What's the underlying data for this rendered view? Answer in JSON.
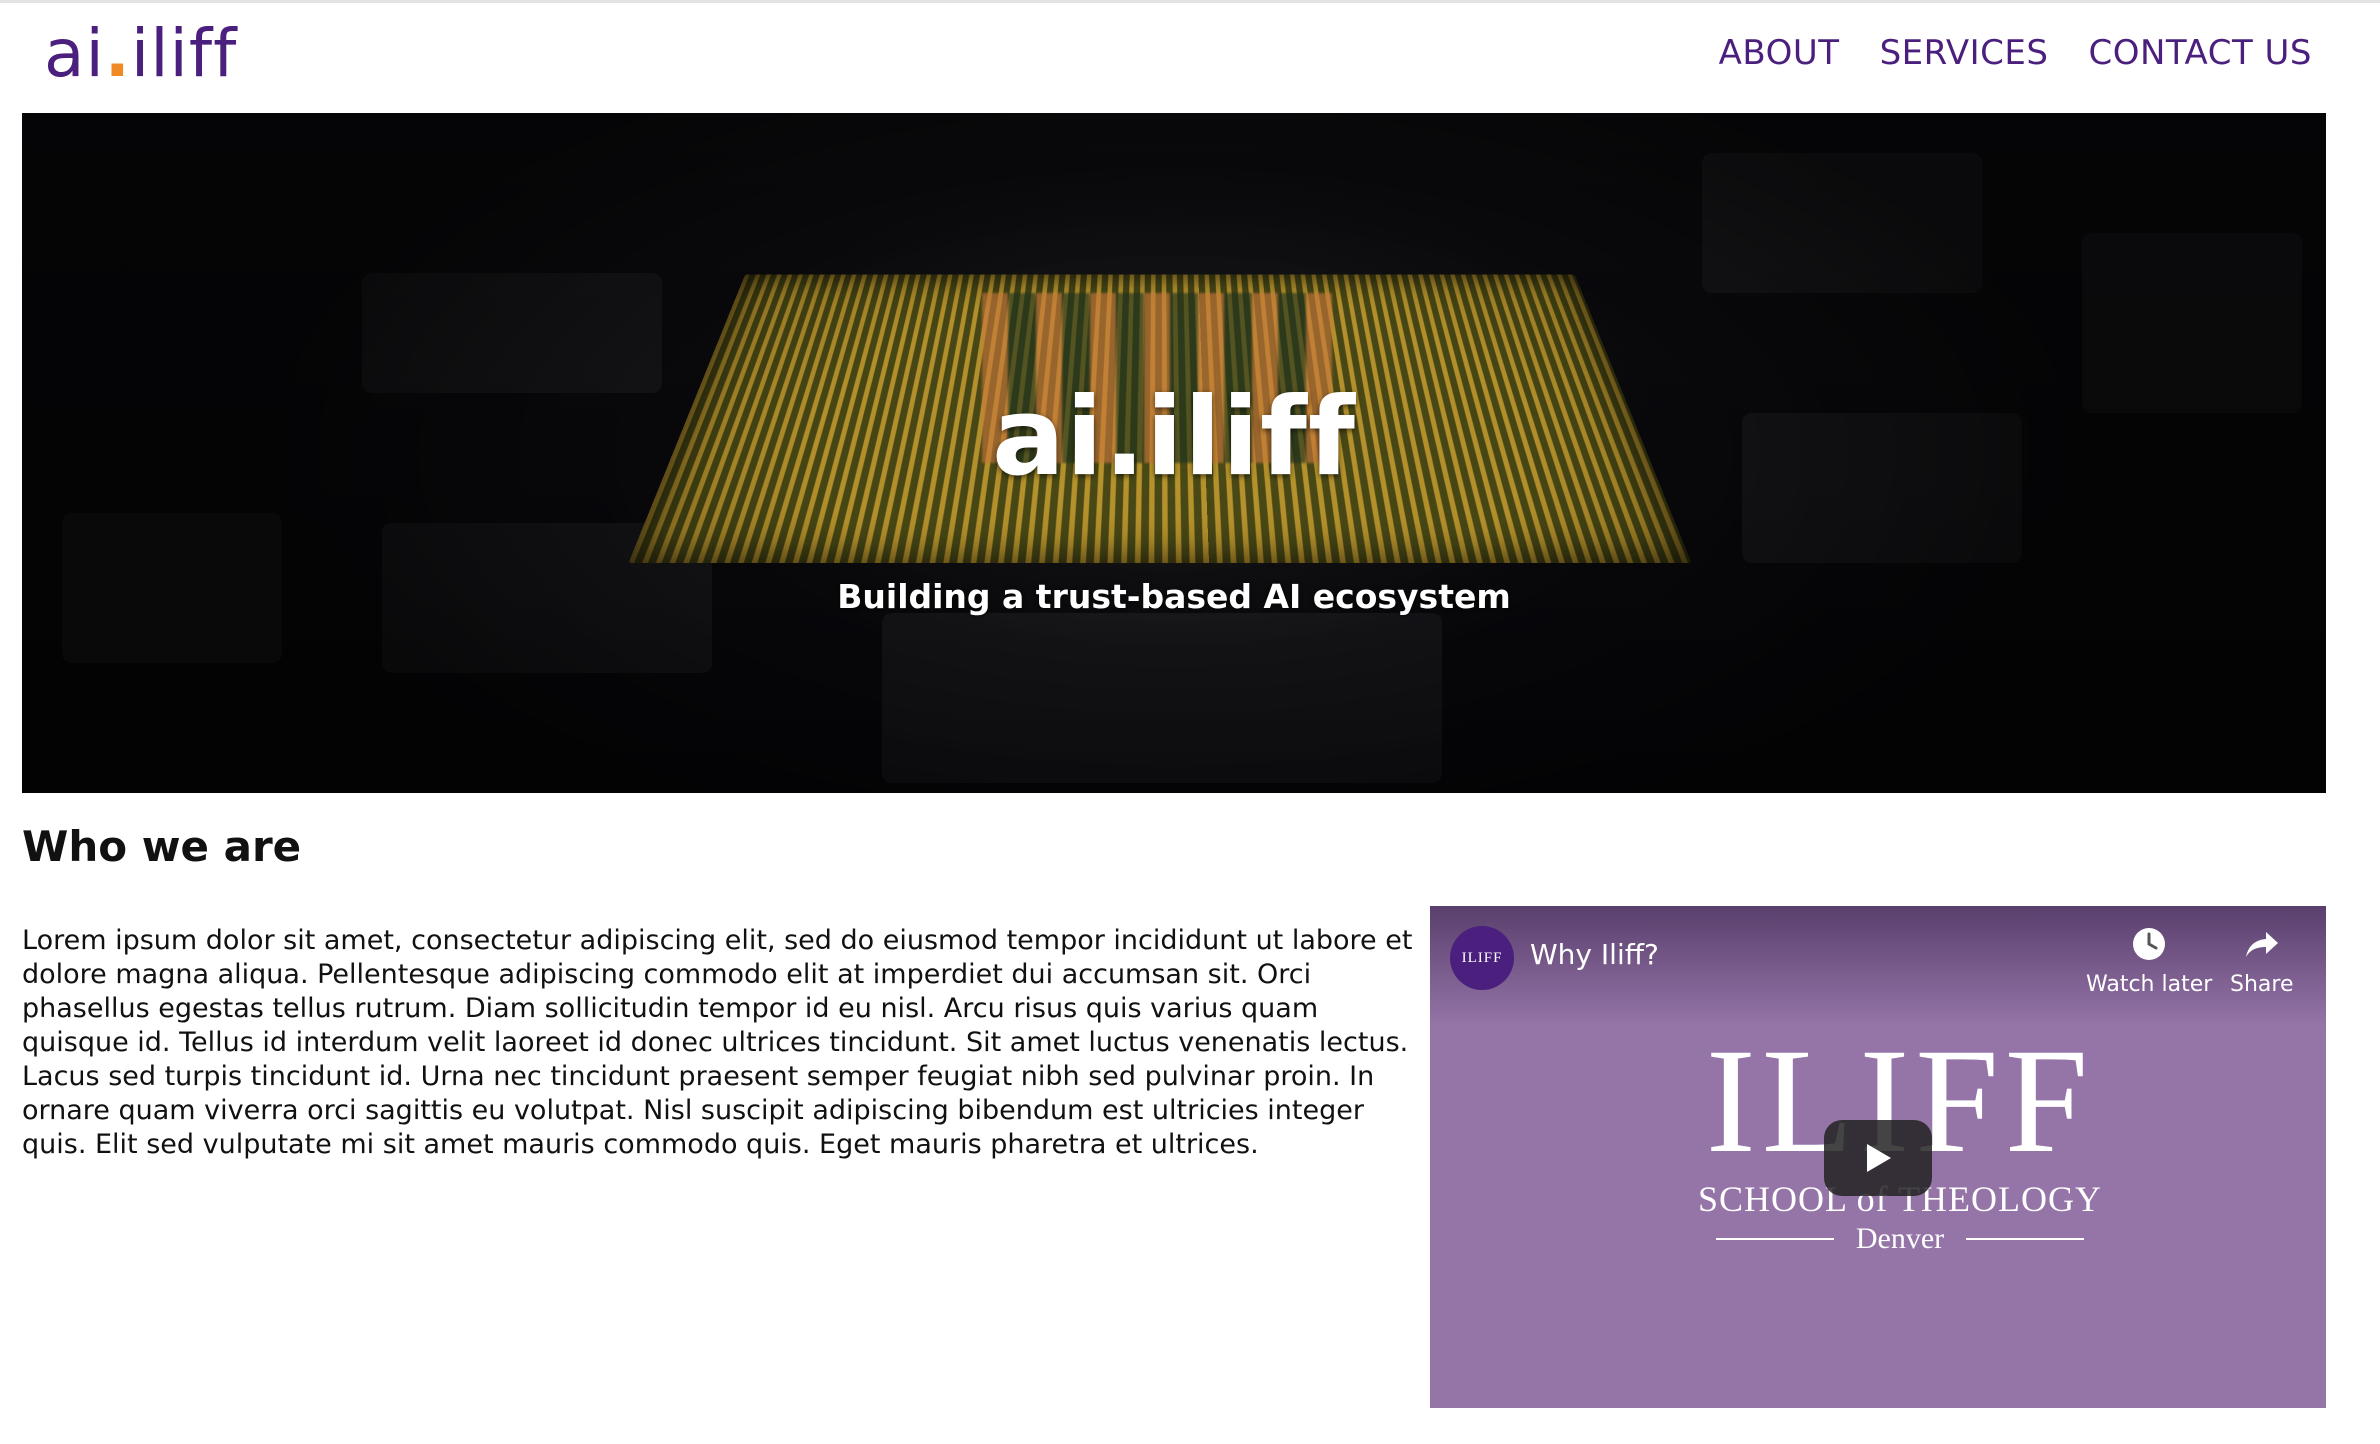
{
  "header": {
    "logo_prefix": "ai",
    "logo_dot": ".",
    "logo_suffix": "iliff",
    "nav": [
      {
        "label": "ABOUT"
      },
      {
        "label": "SERVICES"
      },
      {
        "label": "CONTACT US"
      }
    ]
  },
  "hero": {
    "title": "ai.iliff",
    "subtitle": "Building a trust-based AI ecosystem"
  },
  "about": {
    "heading": "Who we are",
    "body": "Lorem ipsum dolor sit amet, consectetur adipiscing elit, sed do eiusmod tempor incididunt ut labore et dolore magna aliqua. Pellentesque adipiscing commodo elit at imperdiet dui accumsan sit. Orci phasellus egestas tellus rutrum. Diam sollicitudin tempor id eu nisl. Arcu risus quis varius quam quisque id. Tellus id interdum velit laoreet id donec ultrices tincidunt. Sit amet luctus venenatis lectus. Lacus sed turpis tincidunt id. Urna nec tincidunt praesent semper feugiat nibh sed pulvinar proin. In ornare quam viverra orci sagittis eu volutpat. Nisl suscipit adipiscing bibendum est ultricies integer quis. Elit sed vulputate mi sit amet mauris commodo quis. Eget mauris pharetra et ultrices."
  },
  "video": {
    "title": "Why Iliff?",
    "channel_avatar_text": "ILIFF",
    "watch_later_label": "Watch later",
    "share_label": "Share",
    "thumbnail_name": "ILIFF",
    "thumbnail_school": "SCHOOL of THEOLOGY",
    "thumbnail_city": "Denver",
    "background_color": "#9574a8"
  },
  "colors": {
    "brand_purple": "#4b1f7d",
    "logo_dot_orange": "#f08a24"
  }
}
